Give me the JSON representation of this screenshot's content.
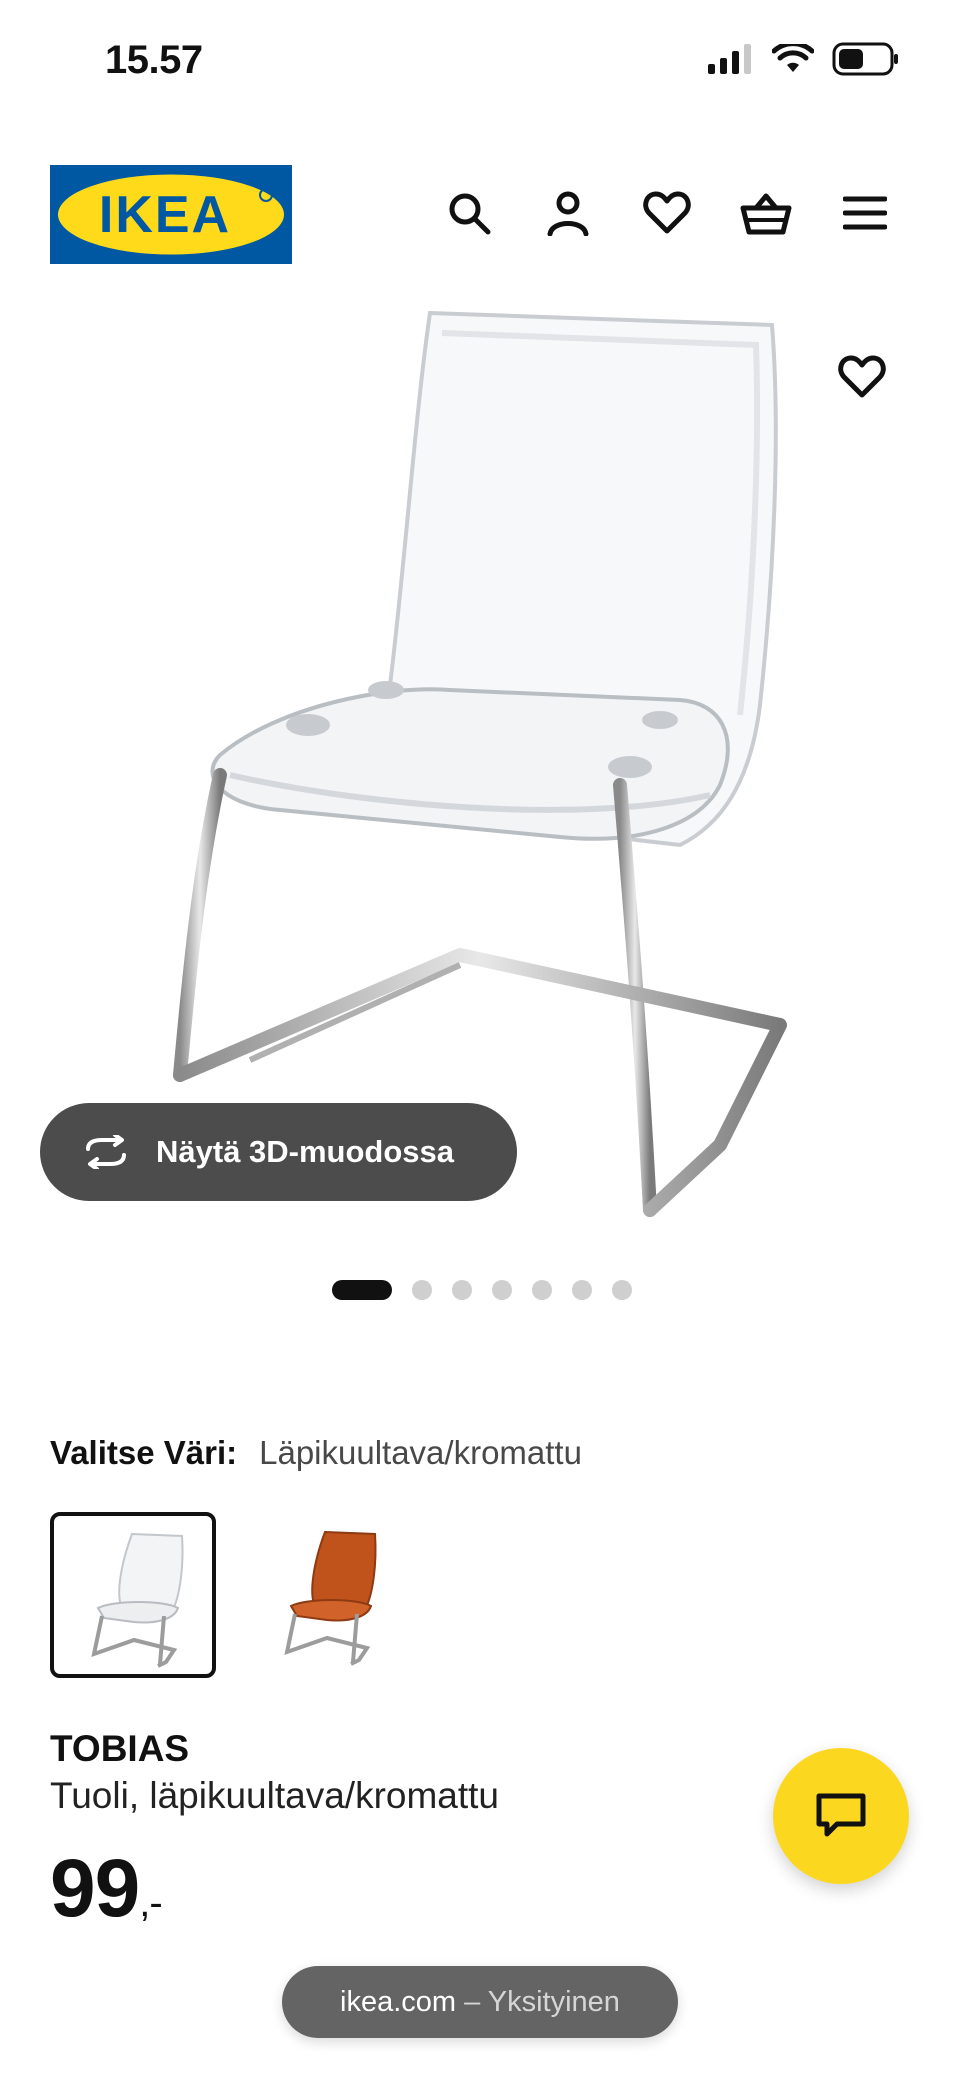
{
  "status_bar": {
    "time": "15.57"
  },
  "header": {
    "logo_text": "IKEA",
    "brand_colors": {
      "blue": "#0058a3",
      "yellow": "#ffda1a"
    },
    "icons": [
      "search-icon",
      "account-icon",
      "heart-icon",
      "basket-icon",
      "menu-icon"
    ]
  },
  "gallery": {
    "view_3d_label": "Näytä 3D-muodossa",
    "image_count": 7,
    "active_index": 0
  },
  "color_selector": {
    "label": "Valitse Väri:",
    "value": "Läpikuultava/kromattu",
    "options": [
      {
        "name": "transparent",
        "selected": true
      },
      {
        "name": "orange",
        "selected": false
      }
    ]
  },
  "product": {
    "name": "TOBIAS",
    "description": "Tuoli, läpikuultava/kromattu",
    "price": "99",
    "price_suffix": ",-"
  },
  "browser": {
    "url": "ikea.com",
    "mode": "– Yksityinen"
  },
  "accent_colors": {
    "chat": "#fcd71f",
    "pill": "#646464"
  }
}
